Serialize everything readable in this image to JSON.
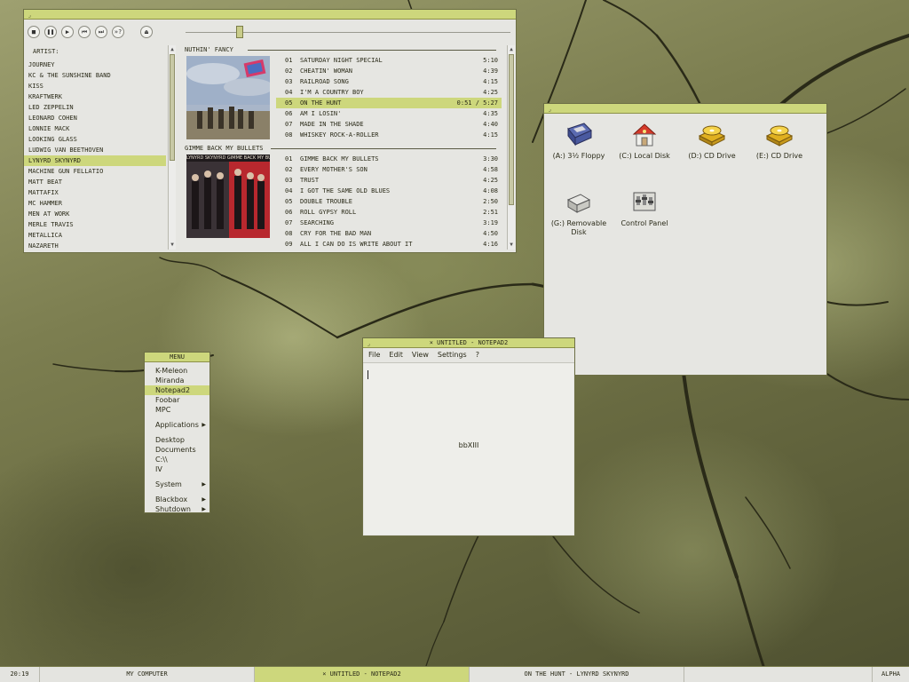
{
  "player": {
    "artist_header": "ARTIST:",
    "artists": [
      {
        "name": "JOURNEY",
        "selected": false
      },
      {
        "name": "KC & THE SUNSHINE BAND",
        "selected": false
      },
      {
        "name": "KISS",
        "selected": false
      },
      {
        "name": "KRAFTWERK",
        "selected": false
      },
      {
        "name": "LED ZEPPELIN",
        "selected": false
      },
      {
        "name": "LEONARD COHEN",
        "selected": false
      },
      {
        "name": "LONNIE MACK",
        "selected": false
      },
      {
        "name": "LOOKING GLASS",
        "selected": false
      },
      {
        "name": "LUDWIG VAN BEETHOVEN",
        "selected": false
      },
      {
        "name": "LYNYRD SKYNYRD",
        "selected": true
      },
      {
        "name": "MACHINE GUN FELLATIO",
        "selected": false
      },
      {
        "name": "MATT BEAT",
        "selected": false
      },
      {
        "name": "MATTAFIX",
        "selected": false
      },
      {
        "name": "MC HAMMER",
        "selected": false
      },
      {
        "name": "MEN AT WORK",
        "selected": false
      },
      {
        "name": "MERLE TRAVIS",
        "selected": false
      },
      {
        "name": "METALLICA",
        "selected": false
      },
      {
        "name": "NAZARETH",
        "selected": false
      }
    ],
    "albums": [
      {
        "title": "NUTHIN' FANCY",
        "tracks": [
          {
            "num": "01",
            "title": "SATURDAY NIGHT SPECIAL",
            "dur": "5:10"
          },
          {
            "num": "02",
            "title": "CHEATIN' WOMAN",
            "dur": "4:39"
          },
          {
            "num": "03",
            "title": "RAILROAD SONG",
            "dur": "4:15"
          },
          {
            "num": "04",
            "title": "I'M A COUNTRY BOY",
            "dur": "4:25"
          },
          {
            "num": "05",
            "title": "ON THE HUNT",
            "dur": "0:51 / 5:27",
            "playing": true
          },
          {
            "num": "06",
            "title": "AM I LOSIN'",
            "dur": "4:35"
          },
          {
            "num": "07",
            "title": "MADE IN THE SHADE",
            "dur": "4:40"
          },
          {
            "num": "08",
            "title": "WHISKEY ROCK-A-ROLLER",
            "dur": "4:15"
          }
        ]
      },
      {
        "title": "GIMME BACK MY BULLETS",
        "tracks": [
          {
            "num": "01",
            "title": "GIMME BACK MY BULLETS",
            "dur": "3:30"
          },
          {
            "num": "02",
            "title": "EVERY MOTHER'S SON",
            "dur": "4:58"
          },
          {
            "num": "03",
            "title": "TRUST",
            "dur": "4:25"
          },
          {
            "num": "04",
            "title": "I GOT THE SAME OLD BLUES",
            "dur": "4:08"
          },
          {
            "num": "05",
            "title": "DOUBLE TROUBLE",
            "dur": "2:50"
          },
          {
            "num": "06",
            "title": "ROLL GYPSY ROLL",
            "dur": "2:51"
          },
          {
            "num": "07",
            "title": "SEARCHING",
            "dur": "3:19"
          },
          {
            "num": "08",
            "title": "CRY FOR THE BAD MAN",
            "dur": "4:50"
          },
          {
            "num": "09",
            "title": "ALL I CAN DO IS WRITE ABOUT IT",
            "dur": "4:16"
          }
        ]
      }
    ],
    "cover2_text": "LYNYRD SKYNYRD  GIMME BACK MY BULLETS",
    "seek_fraction": 0.156
  },
  "mycomputer": {
    "icons": [
      {
        "label": "(A:) 3½ Floppy",
        "icon": "floppy-icon"
      },
      {
        "label": "(C:) Local Disk",
        "icon": "local-disk-icon"
      },
      {
        "label": "(D:) CD Drive",
        "icon": "cd-drive-icon"
      },
      {
        "label": "(E:) CD Drive",
        "icon": "cd-drive-icon"
      },
      {
        "label": "(G:) Removable Disk",
        "icon": "removable-disk-icon"
      },
      {
        "label": "Control Panel",
        "icon": "control-panel-icon"
      }
    ]
  },
  "notepad": {
    "title": "× UNTITLED - NOTEPAD2",
    "menu": [
      "File",
      "Edit",
      "View",
      "Settings",
      "?"
    ],
    "watermark": "bbXIII"
  },
  "menu": {
    "title": "MENU",
    "groups": [
      [
        {
          "label": "K-Meleon"
        },
        {
          "label": "Miranda"
        },
        {
          "label": "Notepad2",
          "selected": true
        },
        {
          "label": "Foobar"
        },
        {
          "label": "MPC"
        }
      ],
      [
        {
          "label": "Applications",
          "sub": true
        }
      ],
      [
        {
          "label": "Desktop"
        },
        {
          "label": "Documents"
        },
        {
          "label": "C:\\\\"
        },
        {
          "label": "IV"
        }
      ],
      [
        {
          "label": "System",
          "sub": true
        }
      ],
      [
        {
          "label": "Blackbox",
          "sub": true
        },
        {
          "label": "Shutdown",
          "sub": true
        }
      ]
    ]
  },
  "taskbar": {
    "clock": "20:19",
    "tasks": [
      {
        "label": "MY COMPUTER",
        "active": false
      },
      {
        "label": "× UNTITLED - NOTEPAD2",
        "active": true
      },
      {
        "label": "ON THE HUNT - LYNYRD SKYNYRD",
        "active": false
      }
    ],
    "workspace": "ALPHA"
  },
  "colors": {
    "accent": "#cdd77c",
    "window_bg": "#e6e6e2",
    "border": "#6d6f46"
  }
}
